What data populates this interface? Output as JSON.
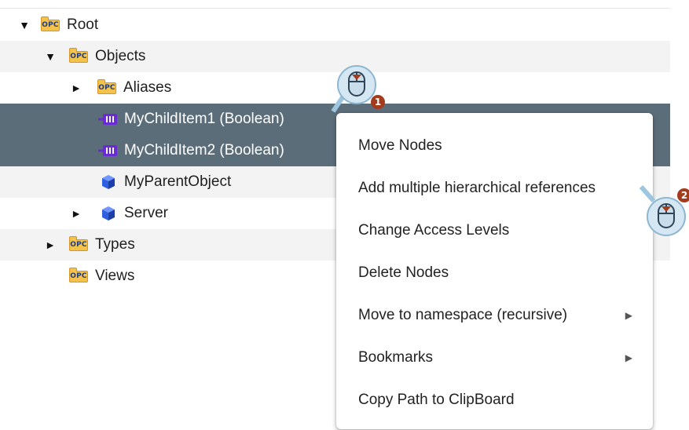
{
  "tree": {
    "nodes": [
      {
        "id": "root",
        "label": "Root",
        "expander": "▼",
        "icon": "opc-folder-icon",
        "opc_text": "OPC"
      },
      {
        "id": "objects",
        "label": "Objects",
        "expander": "▼",
        "icon": "opc-folder-icon",
        "opc_text": "OPC"
      },
      {
        "id": "aliases",
        "label": "Aliases",
        "expander": "►",
        "icon": "opc-folder-icon",
        "opc_text": "OPC"
      },
      {
        "id": "mychilditem1",
        "label": "MyChildItem1 (Boolean)",
        "expander": "",
        "icon": "variable-icon",
        "selected": true
      },
      {
        "id": "mychilditem2",
        "label": "MyChildItem2 (Boolean)",
        "expander": "",
        "icon": "variable-icon",
        "selected": true
      },
      {
        "id": "myparentobject",
        "label": "MyParentObject",
        "expander": "",
        "icon": "object-cube-icon"
      },
      {
        "id": "server",
        "label": "Server",
        "expander": "►",
        "icon": "object-cube-icon"
      },
      {
        "id": "types",
        "label": "Types",
        "expander": "►",
        "icon": "opc-folder-icon",
        "opc_text": "OPC"
      },
      {
        "id": "views",
        "label": "Views",
        "expander": "",
        "icon": "opc-folder-icon",
        "opc_text": "OPC"
      }
    ]
  },
  "context_menu": {
    "items": [
      {
        "label": "Move Nodes",
        "submenu": false
      },
      {
        "label": "Add multiple hierarchical references",
        "submenu": false
      },
      {
        "label": "Change Access Levels",
        "submenu": false
      },
      {
        "label": "Delete Nodes",
        "submenu": false
      },
      {
        "label": "Move to namespace (recursive)",
        "submenu": true,
        "arrow": "▶"
      },
      {
        "label": "Bookmarks",
        "submenu": true,
        "arrow": "▶"
      },
      {
        "label": "Copy Path to ClipBoard",
        "submenu": false
      }
    ]
  },
  "annotations": {
    "step1": "1",
    "step2": "2"
  },
  "colors": {
    "selection": "#5c6d7a",
    "row_alt": "#f3f3f3",
    "opc_folder": "#f4c24d",
    "variable_icon": "#6a2bd6",
    "object_cube": "#2e5fe0",
    "badge": "#a33b1c"
  }
}
